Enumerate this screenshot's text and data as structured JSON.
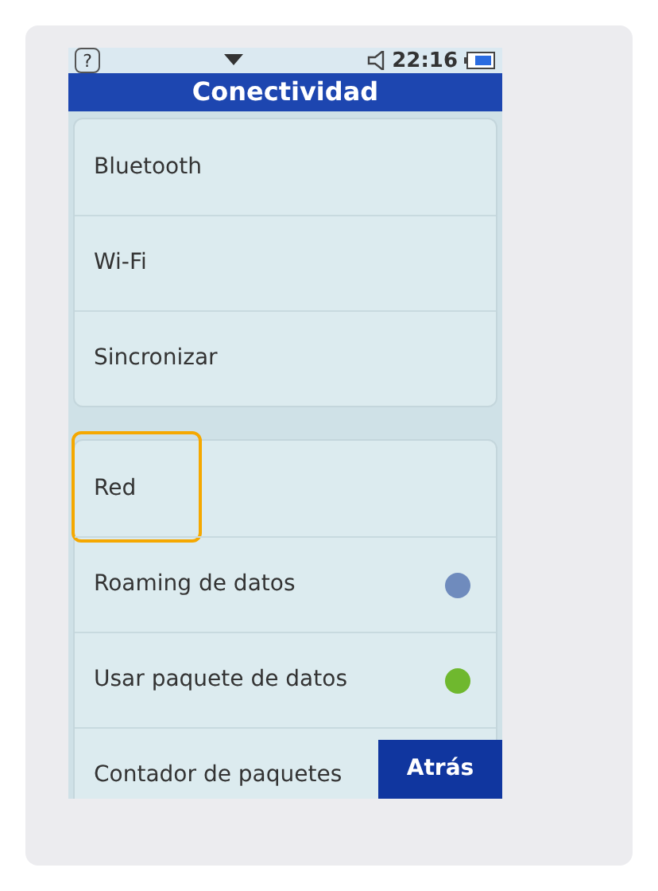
{
  "status_bar": {
    "help": "?",
    "time": "22:16"
  },
  "title": "Conectividad",
  "groups": [
    {
      "items": [
        {
          "label": "Bluetooth"
        },
        {
          "label": "Wi-Fi"
        },
        {
          "label": "Sincronizar"
        }
      ]
    },
    {
      "items": [
        {
          "label": "Red",
          "highlighted": true
        },
        {
          "label": "Roaming de datos",
          "on": false
        },
        {
          "label": "Usar paquete de datos",
          "on": true
        },
        {
          "label": "Contador de paquetes"
        }
      ]
    }
  ],
  "back_button": "Atrás"
}
